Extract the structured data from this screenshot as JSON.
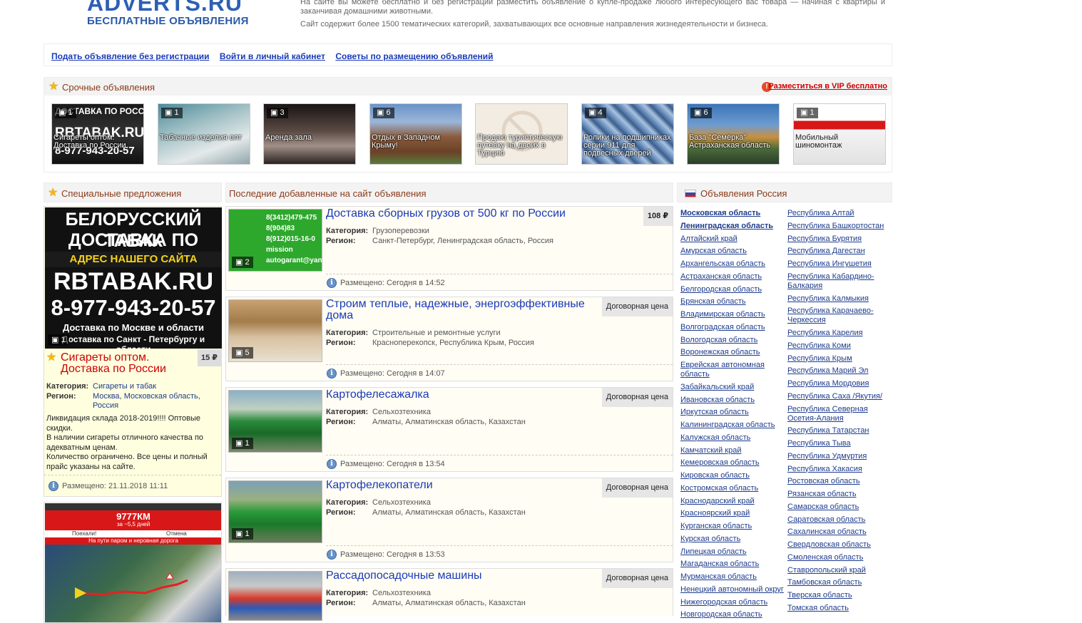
{
  "header": {
    "logo_top": "ADVERTS.RU",
    "logo_sub": "БЕСПЛАТНЫЕ ОБЪЯВЛЕНИЯ",
    "intro_1": "На сайте вы можете бесплатно и без регистрации разместить объявление о купле-продаже любого интересующего вас товара — начиная с квартиры и заканчивая домашними животными.",
    "intro_2": "Сайт содержит более 1500 тематических категорий, захватывающих все основные направления жизнедеятельности и бизнеса."
  },
  "topnav": {
    "post_ad": "Подать объявление без регистрации",
    "login": "Войти в личный кабинет",
    "tips": "Советы по размещению объявлений"
  },
  "urgent": {
    "title": "Срочные объявления",
    "vip_link": "Разместиться в VIP бесплатно",
    "items": [
      {
        "count": "1",
        "caption": "Сигареты оптом. Доставка по России"
      },
      {
        "count": "1",
        "caption": "Табачные изделия опт"
      },
      {
        "count": "3",
        "caption": "Аренда зала"
      },
      {
        "count": "6",
        "caption": "Отдых в Западном Крыму!"
      },
      {
        "count": "",
        "caption": "Продаю туристическую путевку на двоих в Турцию"
      },
      {
        "count": "4",
        "caption": "Ролики на подшипниках серии 911 для подвесных дверей"
      },
      {
        "count": "6",
        "caption": "База \"Семёрка\" Астраханская область"
      },
      {
        "count": "1",
        "caption": "Мобильный шиномонтаж"
      }
    ]
  },
  "special": {
    "title": "Специальные предложения",
    "banner": {
      "line1": "БЕЛОРУССКИЙ ТАБАК",
      "line2": "ДОСТАВКА ПО РОССИИ",
      "line3": "АДРЕС НАШЕГО САЙТА",
      "line4": "RBTABAK.RU",
      "line5": "8-977-943-20-57",
      "line6": "Доставка по Москве и области",
      "line7": "Доставка по Санкт - Петербургу и области"
    },
    "photo_count": "1",
    "price": "15 ₽",
    "name": "Сигареты оптом. Доставка по России",
    "category_label": "Категория:",
    "category": "Сигареты и табак",
    "region_label": "Регион:",
    "region_1": "Москва",
    "region_2": "Московская область",
    "region_3": "Россия",
    "desc_1": "Ликвидация склада 2018-2019!!!! Оптовые скидки.",
    "desc_2": "В наличии сигареты отличного качества по адекватным ценам.",
    "desc_3": "Количество ограничено. Все цены и полный прайс указаны на сайте.",
    "posted": "Размещено: 21.11.2018 11:11",
    "banner2_top": "9777КМ",
    "banner2_sub": "за ~5,5 дней",
    "banner2_line": "На пути паром и неровная дорога",
    "banner2_btn1": "Поехали!",
    "banner2_btn2": "Отмена"
  },
  "latest": {
    "title": "Последние добавленные на сайт объявления",
    "category_label": "Категория:",
    "region_label": "Регион:",
    "listings": [
      {
        "title": "Доставка сборных грузов от 500 кг по России",
        "price": "108 ₽",
        "category": "Грузоперевозки",
        "region": "Санкт-Петербург, Ленинградская область, Россия",
        "posted": "Размещено: Сегодня в 14:52",
        "photos": "2",
        "img_text": "8(3412)479-475\n8(904)83\n8(912)015-16-0\nmission\nautogarant@yan"
      },
      {
        "title": "Строим теплые, надежные, энергоэффективные дома",
        "price": "Договорная цена",
        "category": "Строительные и ремонтные услуги",
        "region": "Красноперекопск, Республика Крым, Россия",
        "posted": "Размещено: Сегодня в 14:07",
        "photos": "5"
      },
      {
        "title": "Картофелесажалка",
        "price": "Договорная цена",
        "category": "Сельхозтехника",
        "region": "Алматы, Алматинская область, Казахстан",
        "posted": "Размещено: Сегодня в 13:54",
        "photos": "1"
      },
      {
        "title": "Картофелекопатели",
        "price": "Договорная цена",
        "category": "Сельхозтехника",
        "region": "Алматы, Алматинская область, Казахстан",
        "posted": "Размещено: Сегодня в 13:53",
        "photos": "1"
      },
      {
        "title": "Рассадопосадочные машины",
        "price": "Договорная цена",
        "category": "Сельхозтехника",
        "region": "Алматы, Алматинская область, Казахстан",
        "posted": "",
        "photos": ""
      }
    ]
  },
  "regions": {
    "title": "Объявления Россия",
    "col1": [
      "Московская область",
      "Ленинградская область",
      "Алтайский край",
      "Амурская область",
      "Архангельская область",
      "Астраханская область",
      "Белгородская область",
      "Брянская область",
      "Владимирская область",
      "Волгоградская область",
      "Вологодская область",
      "Воронежская область",
      "Еврейская автономная область",
      "Забайкальский край",
      "Ивановская область",
      "Иркутская область",
      "Калининградская область",
      "Калужская область",
      "Камчатский край",
      "Кемеровская область",
      "Кировская область",
      "Костромская область",
      "Краснодарский край",
      "Красноярский край",
      "Курганская область",
      "Курская область",
      "Липецкая область",
      "Магаданская область",
      "Мурманская область",
      "Ненецкий автономный округ",
      "Нижегородская область",
      "Новгородская область"
    ],
    "col2": [
      "Республика Алтай",
      "Республика Башкортостан",
      "Республика Бурятия",
      "Республика Дагестан",
      "Республика Ингушетия",
      "Республика Кабардино-Балкария",
      "Республика Калмыкия",
      "Республика Карачаево-Черкессия",
      "Республика Карелия",
      "Республика Коми",
      "Республика Крым",
      "Республика Марий Эл",
      "Республика Мордовия",
      "Республика Саха /Якутия/",
      "Республика Северная Осетия-Алания",
      "Республика Татарстан",
      "Республика Тыва",
      "Республика Удмуртия",
      "Республика Хакасия",
      "Ростовская область",
      "Рязанская область",
      "Самарская область",
      "Саратовская область",
      "Сахалинская область",
      "Свердловская область",
      "Смоленская область",
      "Ставропольский край",
      "Тамбовская область",
      "Тверская область",
      "Томская область"
    ],
    "bold_count": 2
  }
}
